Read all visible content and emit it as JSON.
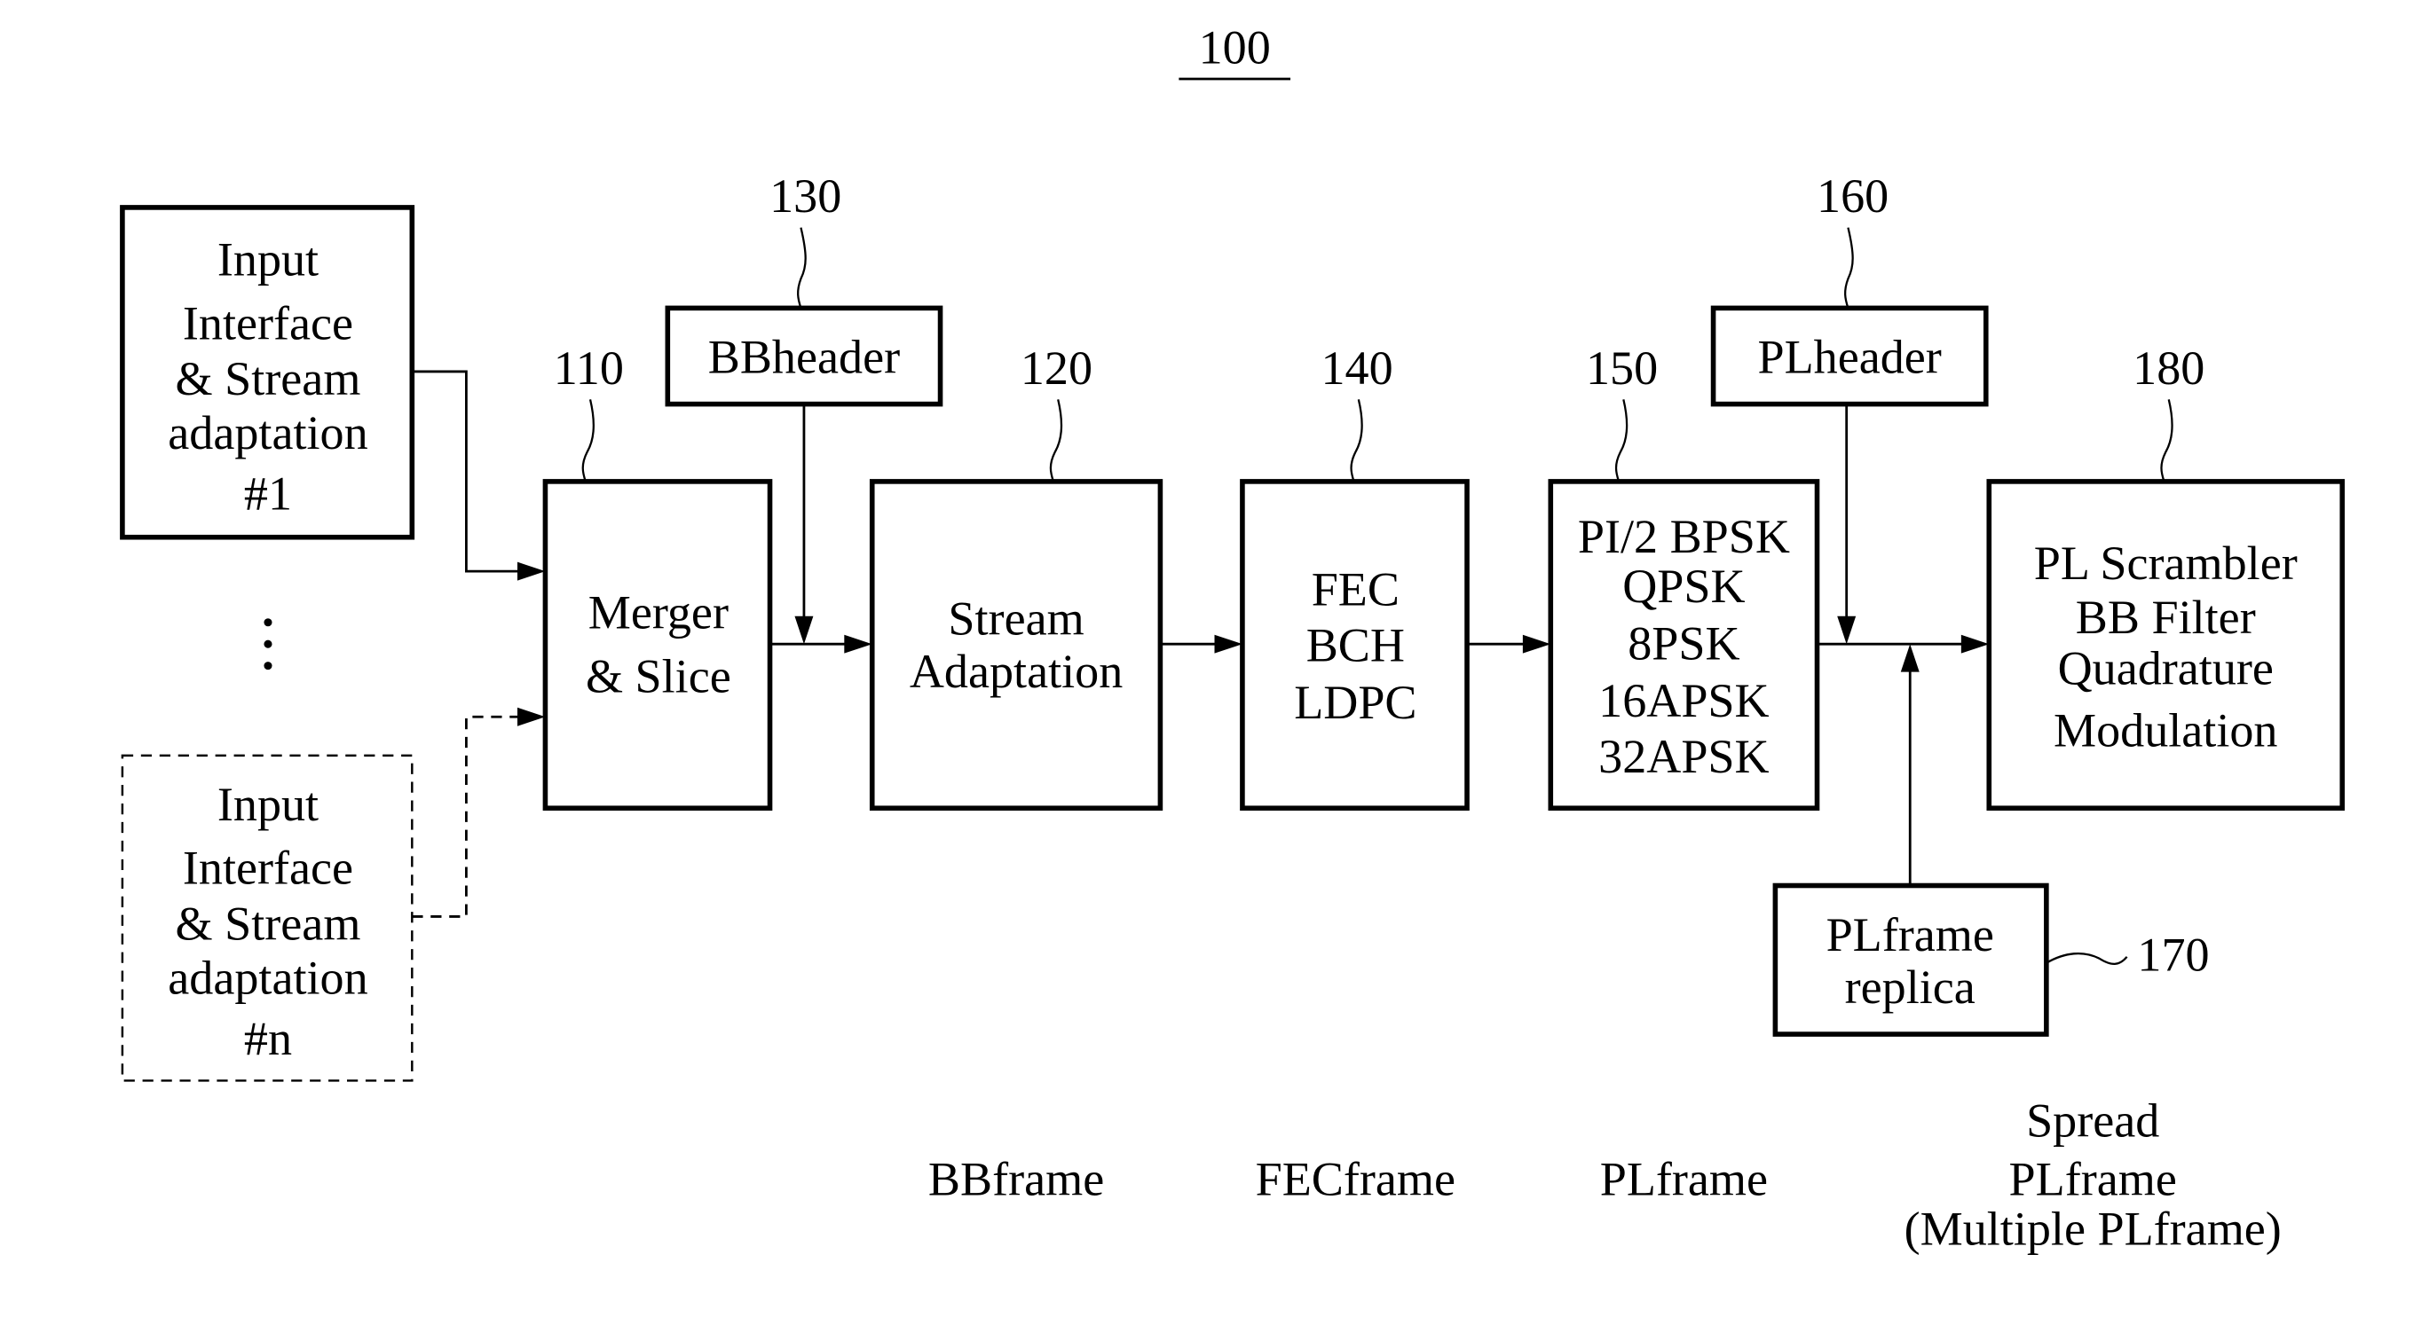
{
  "figure": {
    "reference": "100"
  },
  "blocks": {
    "input_1": {
      "lines": [
        "Input",
        "Interface",
        "& Stream",
        "adaptation",
        "#1"
      ]
    },
    "input_n": {
      "lines": [
        "Input",
        "Interface",
        "& Stream",
        "adaptation",
        "#n"
      ]
    },
    "ellipsis": "⋮",
    "merger": {
      "ref": "110",
      "lines": [
        "Merger",
        "& Slice"
      ]
    },
    "bbheader": {
      "ref": "130",
      "lines": [
        "BBheader"
      ]
    },
    "stream_adaptation": {
      "ref": "120",
      "lines": [
        "Stream",
        "Adaptation"
      ]
    },
    "fec": {
      "ref": "140",
      "lines": [
        "FEC",
        "BCH",
        "LDPC"
      ]
    },
    "modulation": {
      "ref": "150",
      "lines": [
        "PI/2 BPSK",
        "QPSK",
        "8PSK",
        "16APSK",
        "32APSK"
      ]
    },
    "plheader": {
      "ref": "160",
      "lines": [
        "PLheader"
      ]
    },
    "pl_scrambler": {
      "ref": "180",
      "lines": [
        "PL Scrambler",
        "BB Filter",
        "Quadrature",
        "Modulation"
      ]
    },
    "plframe_replica": {
      "ref": "170",
      "lines": [
        "PLframe",
        "replica"
      ]
    }
  },
  "frame_labels": {
    "bbframe": "BBframe",
    "fecframe": "FECframe",
    "plframe": "PLframe",
    "spread": [
      "Spread",
      "PLframe",
      "(Multiple PLframe)"
    ]
  }
}
